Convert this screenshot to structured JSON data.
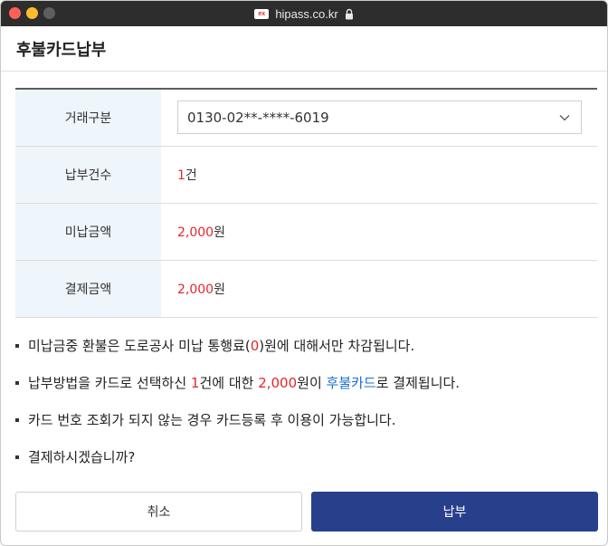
{
  "browser": {
    "url": "hipass.co.kr",
    "favicon_text": "ex"
  },
  "header": {
    "title": "후불카드납부"
  },
  "table": {
    "rows": [
      {
        "label": "거래구분",
        "selected_card": "0130-02**-****-6019"
      },
      {
        "label": "납부건수",
        "value_number": "1",
        "value_unit": "건"
      },
      {
        "label": "미납금액",
        "value_number": "2,000",
        "value_unit": "원"
      },
      {
        "label": "결제금액",
        "value_number": "2,000",
        "value_unit": "원"
      }
    ]
  },
  "notes": {
    "n1": {
      "a": "미납금중 환불은 도로공사 미납 통행료(",
      "b": "0",
      "c": ")원에 대해서만 차감됩니다."
    },
    "n2": {
      "a": "납부방법을 카드로 선택하신 ",
      "b": "1",
      "c": "건에 대한 ",
      "d": "2,000",
      "e": "원이 ",
      "f": "후불카드",
      "g": "로 결제됩니다."
    },
    "n3": {
      "text": "카드 번호 조회가 되지 않는 경우 카드등록 후 이용이 가능합니다."
    },
    "n4": {
      "text": "결제하시겠습니까?"
    }
  },
  "buttons": {
    "cancel": "취소",
    "pay": "납부"
  },
  "colors": {
    "accent_red": "#e3262b",
    "accent_blue": "#1a6fd0",
    "pay_button": "#28408c",
    "label_bg": "#eef5fb"
  },
  "icons": {
    "lock": "lock-icon",
    "dropdown": "chevron-down-icon"
  }
}
